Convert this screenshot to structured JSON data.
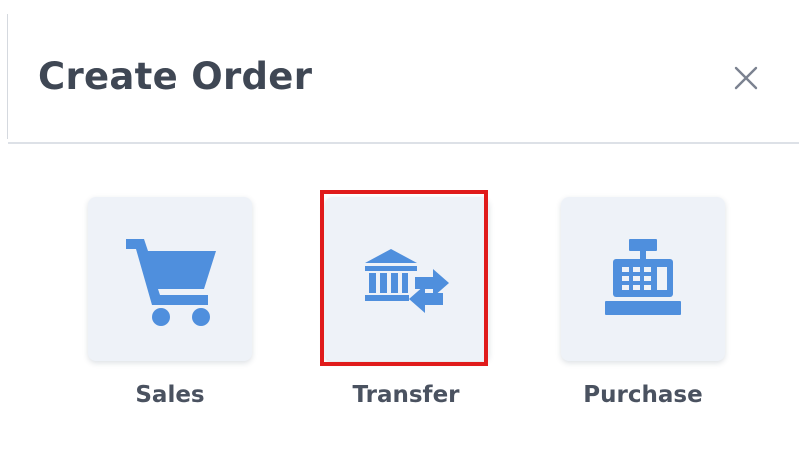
{
  "dialog": {
    "title": "Create Order",
    "close_icon": "close-icon",
    "accent_color": "#4f8fdd",
    "highlight_color": "#e01b1b"
  },
  "options": [
    {
      "label": "Sales",
      "icon": "shopping-cart-icon"
    },
    {
      "label": "Transfer",
      "icon": "bank-transfer-icon",
      "highlighted": true
    },
    {
      "label": "Purchase",
      "icon": "cash-register-icon"
    }
  ]
}
